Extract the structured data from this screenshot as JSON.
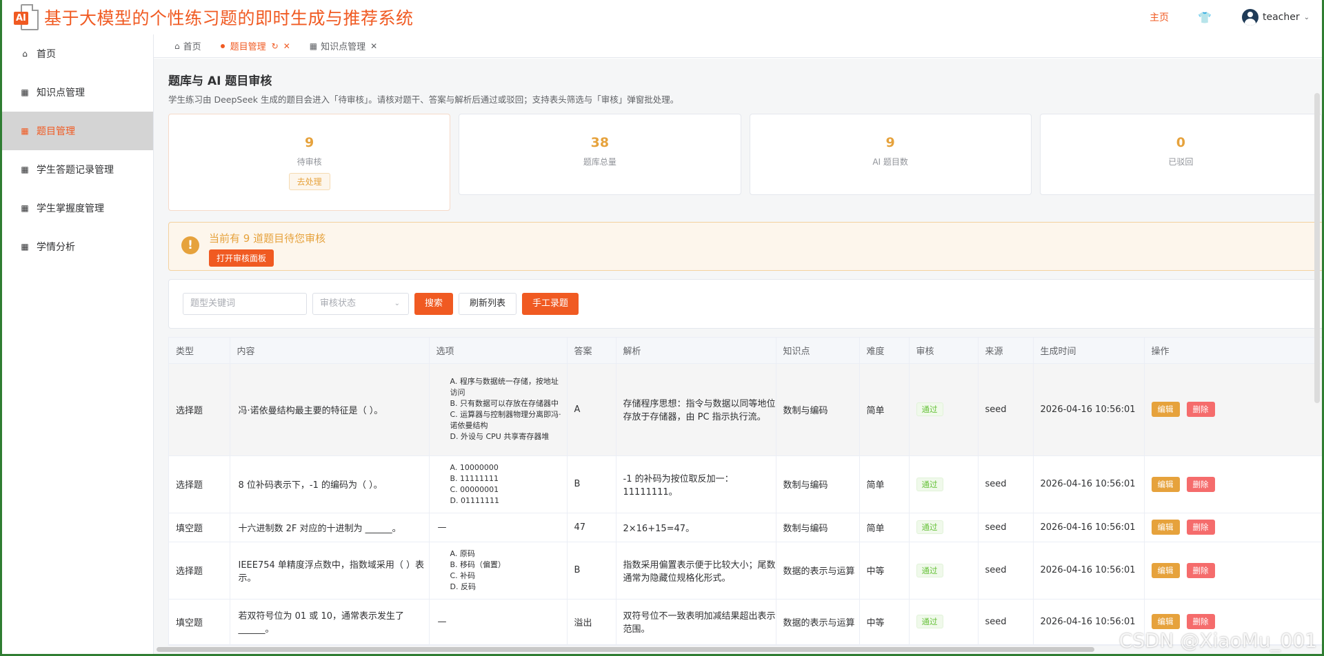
{
  "header": {
    "logo_text": "AI",
    "app_title": "基于大模型的个性练习题的即时生成与推荐系统",
    "nav_home": "主页",
    "username": "teacher"
  },
  "sidebar": {
    "items": [
      {
        "label": "首页",
        "icon": "home-icon"
      },
      {
        "label": "知识点管理",
        "icon": "grid-icon"
      },
      {
        "label": "题目管理",
        "icon": "grid-icon",
        "active": true
      },
      {
        "label": "学生答题记录管理",
        "icon": "grid-icon"
      },
      {
        "label": "学生掌握度管理",
        "icon": "grid-icon"
      },
      {
        "label": "学情分析",
        "icon": "grid-icon"
      }
    ]
  },
  "tabs": [
    {
      "label": "首页"
    },
    {
      "label": "题目管理",
      "active": true
    },
    {
      "label": "知识点管理"
    }
  ],
  "page": {
    "title": "题库与 AI 题目审核",
    "desc": "学生练习由 DeepSeek 生成的题目会进入「待审核」。请核对题干、答案与解析后通过或驳回；支持表头筛选与「审核」弹窗批处理。"
  },
  "stats": [
    {
      "value": "9",
      "label": "待审核",
      "action": "去处理"
    },
    {
      "value": "38",
      "label": "题库总量"
    },
    {
      "value": "9",
      "label": "AI 题目数"
    },
    {
      "value": "0",
      "label": "已驳回"
    }
  ],
  "alert": {
    "title": "当前有 9 道题目待您审核",
    "button": "打开审核面板"
  },
  "filter": {
    "keyword_placeholder": "题型关键词",
    "status_placeholder": "审核状态",
    "search": "搜索",
    "refresh": "刷新列表",
    "manual": "手工录题"
  },
  "table": {
    "columns": [
      "类型",
      "内容",
      "选项",
      "答案",
      "解析",
      "知识点",
      "难度",
      "审核",
      "来源",
      "生成时间",
      "操作"
    ],
    "rows": [
      {
        "type": "选择题",
        "content": "冯·诺依曼结构最主要的特征是（ ）。",
        "options": [
          "A. 程序与数据统一存储，按地址访问",
          "B. 只有数据可以存放在存储器中",
          "C. 运算器与控制器物理分离即冯·诺依曼结构",
          "D. 外设与 CPU 共享寄存器堆"
        ],
        "answer": "A",
        "analysis": "存储程序思想：指令与数据以同等地位存放于存储器，由 PC 指示执行流。",
        "kp": "数制与编码",
        "difficulty": "简单",
        "status": "通过",
        "source": "seed",
        "time": "2026-04-16 10:56:01"
      },
      {
        "type": "选择题",
        "content": "8 位补码表示下，-1 的编码为（ ）。",
        "options": [
          "A. 10000000",
          "B. 11111111",
          "C. 00000001",
          "D. 01111111"
        ],
        "answer": "B",
        "analysis": "-1 的补码为按位取反加一：11111111。",
        "kp": "数制与编码",
        "difficulty": "简单",
        "status": "通过",
        "source": "seed",
        "time": "2026-04-16 10:56:01"
      },
      {
        "type": "填空题",
        "content": "十六进制数 2F 对应的十进制为 ______。",
        "options_text": "—",
        "answer": "47",
        "analysis": "2×16+15=47。",
        "kp": "数制与编码",
        "difficulty": "简单",
        "status": "通过",
        "source": "seed",
        "time": "2026-04-16 10:56:01"
      },
      {
        "type": "选择题",
        "content": "IEEE754 单精度浮点数中，指数域采用（ ）表示。",
        "options": [
          "A. 原码",
          "B. 移码（偏置）",
          "C. 补码",
          "D. 反码"
        ],
        "answer": "B",
        "analysis": "指数采用偏置表示便于比较大小；尾数通常为隐藏位规格化形式。",
        "kp": "数据的表示与运算",
        "difficulty": "中等",
        "status": "通过",
        "source": "seed",
        "time": "2026-04-16 10:56:01"
      },
      {
        "type": "填空题",
        "content": "若双符号位为 01 或 10，通常表示发生了 ______。",
        "options_text": "—",
        "answer": "溢出",
        "analysis": "双符号位不一致表明加减结果超出表示范围。",
        "kp": "数据的表示与运算",
        "difficulty": "中等",
        "status": "通过",
        "source": "seed",
        "time": "2026-04-16 10:56:01"
      }
    ],
    "edit": "编辑",
    "delete": "删除"
  },
  "watermark": "CSDN @XiaoMu_001",
  "colors": {
    "accent": "#f05a22",
    "warning": "#e6a23c",
    "success": "#67c23a",
    "danger": "#f56c6c"
  }
}
